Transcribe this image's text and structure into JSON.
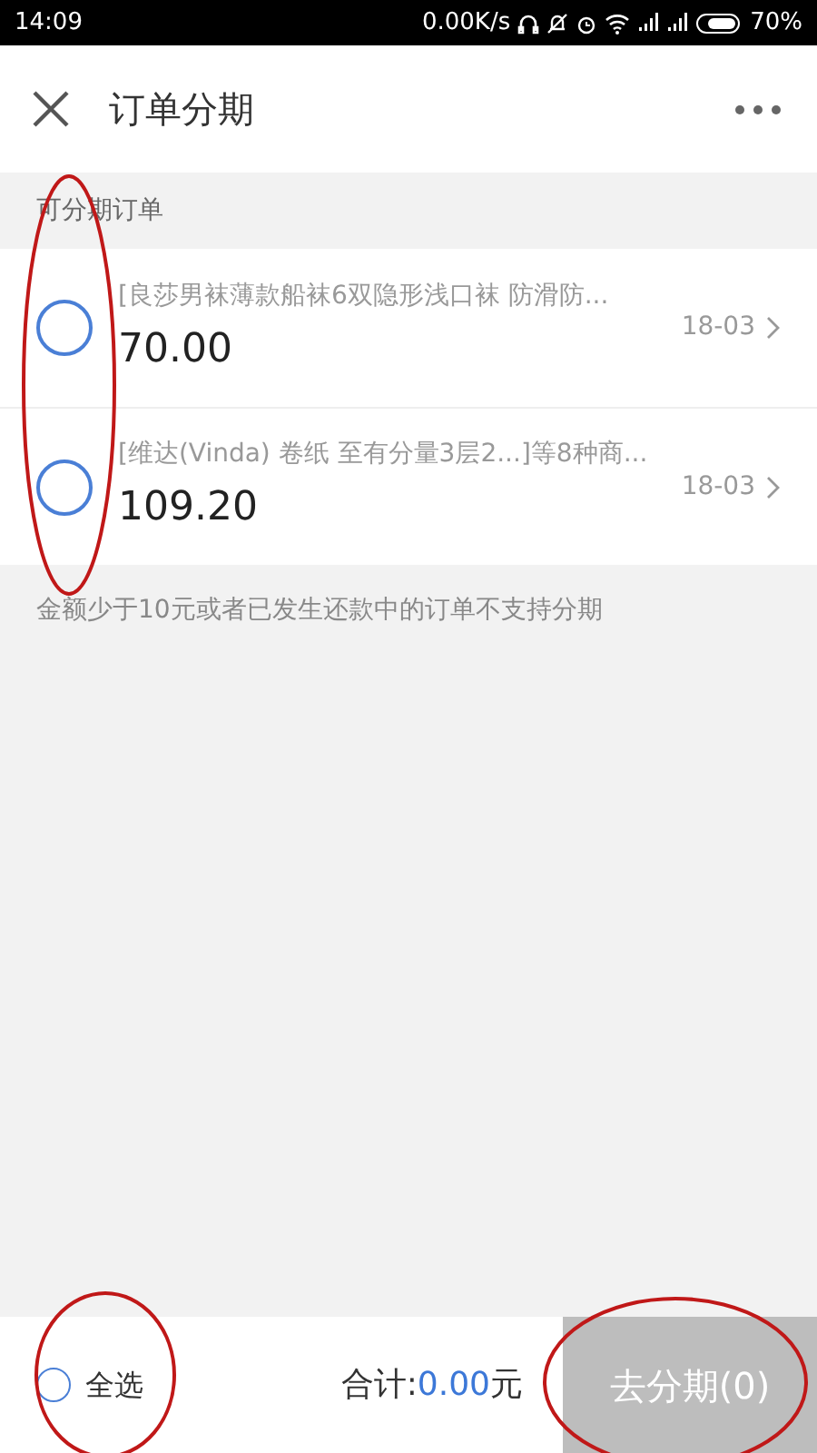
{
  "status_bar": {
    "time": "14:09",
    "network_speed": "0.00K/s",
    "battery": "70%"
  },
  "header": {
    "title": "订单分期"
  },
  "section_label": "可分期订单",
  "orders": [
    {
      "title": "[良莎男袜薄款船袜6双隐形浅口袜 防滑防...",
      "amount": "70.00",
      "date": "18-03",
      "selected": false
    },
    {
      "title": "[维达(Vinda) 卷纸 至有分量3层2...]等8种商...",
      "amount": "109.20",
      "date": "18-03",
      "selected": false
    }
  ],
  "note": "金额少于10元或者已发生还款中的订单不支持分期",
  "footer": {
    "select_all": {
      "label": "全选",
      "selected": false
    },
    "total_label": "合计:",
    "total_amount": "0.00",
    "total_unit": "元",
    "button": {
      "label": "去分期(0)",
      "disabled": true
    }
  }
}
